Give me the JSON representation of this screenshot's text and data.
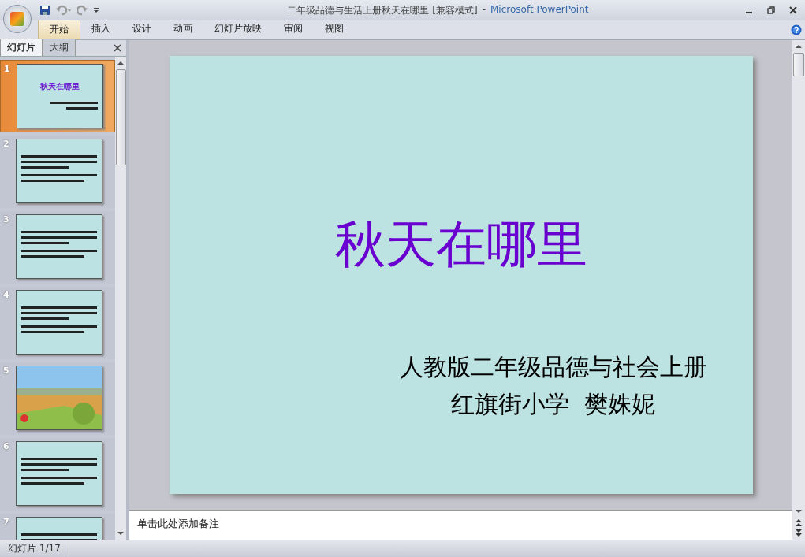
{
  "title_bar": {
    "document_title": "二年级品德与生活上册秋天在哪里 [兼容模式]",
    "separator": "-",
    "app_name": "Microsoft PowerPoint"
  },
  "ribbon_tabs": [
    {
      "label": "开始",
      "selected": true
    },
    {
      "label": "插入",
      "selected": false
    },
    {
      "label": "设计",
      "selected": false
    },
    {
      "label": "动画",
      "selected": false
    },
    {
      "label": "幻灯片放映",
      "selected": false
    },
    {
      "label": "审阅",
      "selected": false
    },
    {
      "label": "视图",
      "selected": false
    }
  ],
  "pane_tabs": [
    {
      "label": "幻灯片",
      "selected": true
    },
    {
      "label": "大纲",
      "selected": false
    }
  ],
  "thumbnails": [
    {
      "number": "1",
      "selected": true,
      "kind": "title",
      "title": "秋天在哪里"
    },
    {
      "number": "2",
      "selected": false,
      "kind": "text"
    },
    {
      "number": "3",
      "selected": false,
      "kind": "text"
    },
    {
      "number": "4",
      "selected": false,
      "kind": "text"
    },
    {
      "number": "5",
      "selected": false,
      "kind": "picture"
    },
    {
      "number": "6",
      "selected": false,
      "kind": "text"
    },
    {
      "number": "7",
      "selected": false,
      "kind": "text"
    }
  ],
  "slide": {
    "title": "秋天在哪里",
    "subtitle_lines": [
      "人教版二年级品德与社会上册",
      "红旗街小学  樊姝妮"
    ]
  },
  "notes": {
    "placeholder": "单击此处添加备注"
  },
  "status_bar": {
    "slide_counter": "幻灯片 1/17"
  }
}
